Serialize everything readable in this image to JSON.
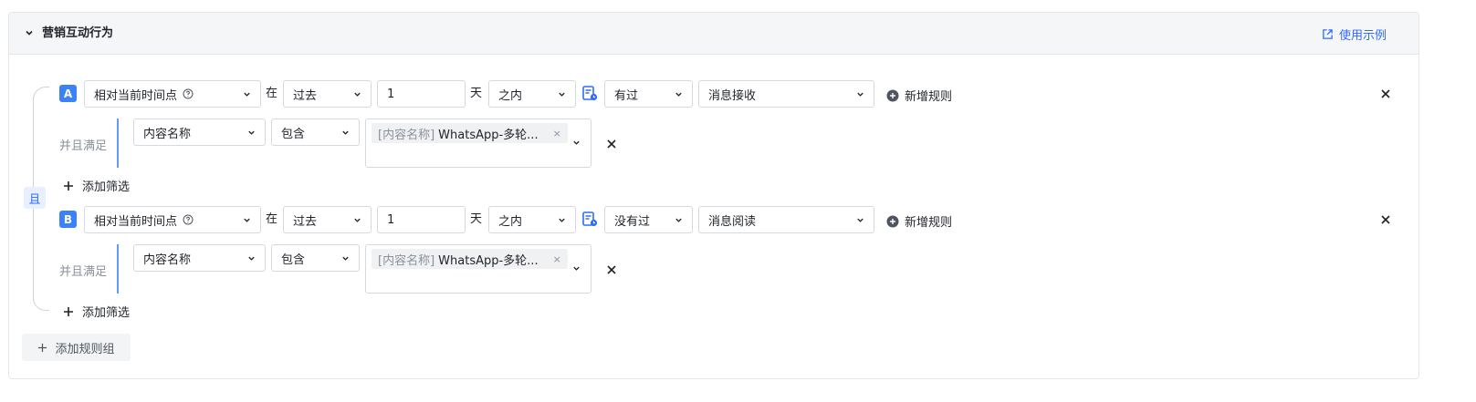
{
  "section": {
    "title": "营销互动行为",
    "example_link": "使用示例"
  },
  "group": {
    "connector": "且",
    "add_group_label": "添加规则组"
  },
  "rules": [
    {
      "badge": "A",
      "time_ref": "相对当前时间点",
      "in_label": "在",
      "period": "过去",
      "amount": "1",
      "unit_label": "天",
      "range": "之内",
      "occurrence": "有过",
      "event": "消息接收",
      "add_rule_label": "新增规则",
      "and_label": "并且满足",
      "filter": {
        "field": "内容名称",
        "operator": "包含",
        "tag_key": "[内容名称]",
        "tag_value": "WhatsApp-多轮...",
        "tag_remove": "×"
      },
      "add_filter_label": "添加筛选"
    },
    {
      "badge": "B",
      "time_ref": "相对当前时间点",
      "in_label": "在",
      "period": "过去",
      "amount": "1",
      "unit_label": "天",
      "range": "之内",
      "occurrence": "没有过",
      "event": "消息阅读",
      "add_rule_label": "新增规则",
      "and_label": "并且满足",
      "filter": {
        "field": "内容名称",
        "operator": "包含",
        "tag_key": "[内容名称]",
        "tag_value": "WhatsApp-多轮...",
        "tag_remove": "×"
      },
      "add_filter_label": "添加筛选"
    }
  ],
  "colors": {
    "accent": "#2f6bff",
    "badge": "#3b82f6",
    "header_bg": "#f5f6f8",
    "border": "#d6d9de"
  },
  "icons": [
    "chevron-down-icon",
    "external-link-icon",
    "help-circle-icon",
    "calendar-icon",
    "plus-circle-icon",
    "plus-icon",
    "close-icon"
  ]
}
